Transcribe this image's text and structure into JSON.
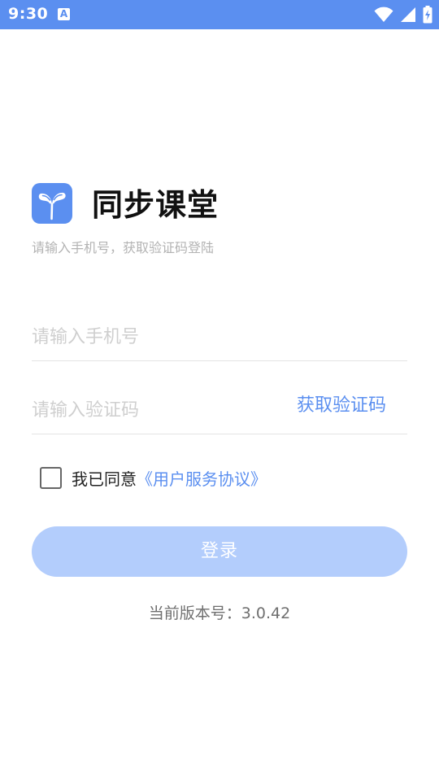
{
  "status_bar": {
    "time": "9:30",
    "notification_glyph": "A",
    "icons": [
      "wifi-icon",
      "cell-signal-icon",
      "battery-charging-icon"
    ]
  },
  "app": {
    "title": "同步课堂",
    "subtitle": "请输入手机号，获取验证码登陆",
    "logo_icon": "sprout-icon",
    "accent_color": "#5b8ff0"
  },
  "form": {
    "phone_value": "",
    "phone_placeholder": "请输入手机号",
    "code_value": "",
    "code_placeholder": "请输入验证码",
    "get_code_label": "获取验证码",
    "agree_checked": false,
    "agree_text": "我已同意",
    "agree_link": "《用户服务协议》",
    "login_label": "登录"
  },
  "footer": {
    "version": "当前版本号：3.0.42"
  }
}
